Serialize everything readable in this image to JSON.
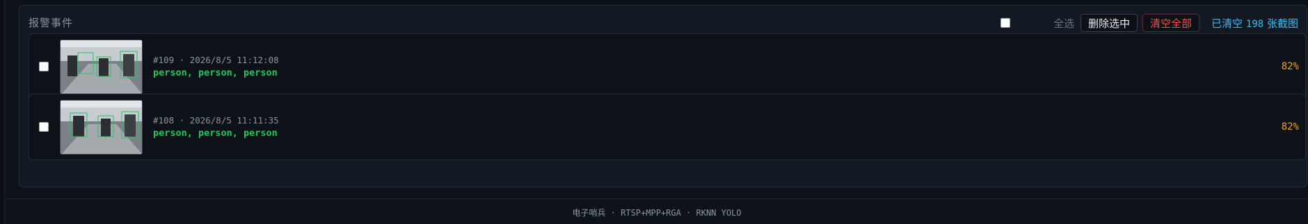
{
  "panel": {
    "title": "报警事件",
    "select_all_label": "全选",
    "delete_selected_label": "删除选中",
    "clear_all_label": "清空全部",
    "cleared_prefix": "已清空",
    "cleared_count": "198",
    "cleared_suffix": "张截图"
  },
  "events": [
    {
      "meta": "#109 · 2026/8/5 11:12:08",
      "labels": "person, person, person",
      "confidence": "82%"
    },
    {
      "meta": "#108 · 2026/8/5 11:11:35",
      "labels": "person, person, person",
      "confidence": "82%"
    }
  ],
  "footer": {
    "text": "电子哨兵 · RTSP+MPP+RGA · RKNN YOLO"
  },
  "colors": {
    "accent_cyan": "#38bdf8",
    "label_green": "#22c55e",
    "confidence_orange": "#f0a020",
    "danger_red": "#f85149"
  }
}
